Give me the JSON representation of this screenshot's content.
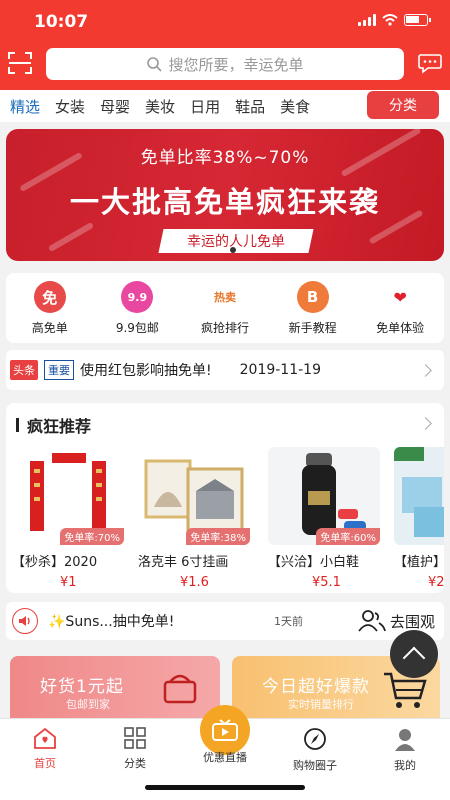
{
  "status": {
    "time": "10:07"
  },
  "search": {
    "placeholder": "搜您所要，幸运免单"
  },
  "tabs": [
    "精选",
    "女装",
    "母婴",
    "美妆",
    "日用",
    "鞋品",
    "美食"
  ],
  "category_button": "分类",
  "banner": {
    "line1": "免单比率38%~70%",
    "line2": "一大批高免单疯狂来袭",
    "line3": "幸运的人儿免单"
  },
  "quick_icons": [
    {
      "label": "高免单",
      "glyph": "免",
      "color": "#e84a4a"
    },
    {
      "label": "9.9包邮",
      "glyph": "9.9",
      "color": "#e848a0"
    },
    {
      "label": "疯抢排行",
      "glyph": "热卖",
      "color": "#e8762a"
    },
    {
      "label": "新手教程",
      "glyph": "B",
      "color": "#f07a3a"
    },
    {
      "label": "免单体验",
      "glyph": "❤",
      "color": "#e02030"
    }
  ],
  "news": {
    "tag1": "头条",
    "tag2": "重要",
    "text": "使用红包影响抽免单!",
    "date": "2019-11-19"
  },
  "recommend": {
    "title": "疯狂推荐",
    "products": [
      {
        "name": "【秒杀】2020",
        "rate": "免单率:70%",
        "price": "¥1"
      },
      {
        "name": "洛克丰 6寸挂画",
        "rate": "免单率:38%",
        "price": "¥1.6"
      },
      {
        "name": "【兴洽】小白鞋",
        "rate": "免单率:60%",
        "price": "¥5.1"
      },
      {
        "name": "【植护】",
        "rate": "",
        "price": "¥2"
      }
    ]
  },
  "live_feed": {
    "text": "✨Suns...抽中免单!",
    "ago": "1天前",
    "action": "去围观"
  },
  "promo_cards": [
    {
      "title": "好货1元起",
      "subtitle": "包邮到家"
    },
    {
      "title": "今日超好爆款",
      "subtitle": "实时销量排行"
    }
  ],
  "bottom_nav": [
    "首页",
    "分类",
    "优惠直播",
    "购物圈子",
    "我的"
  ],
  "colors": {
    "brand_red": "#f23a30",
    "accent_orange": "#f5a524"
  }
}
